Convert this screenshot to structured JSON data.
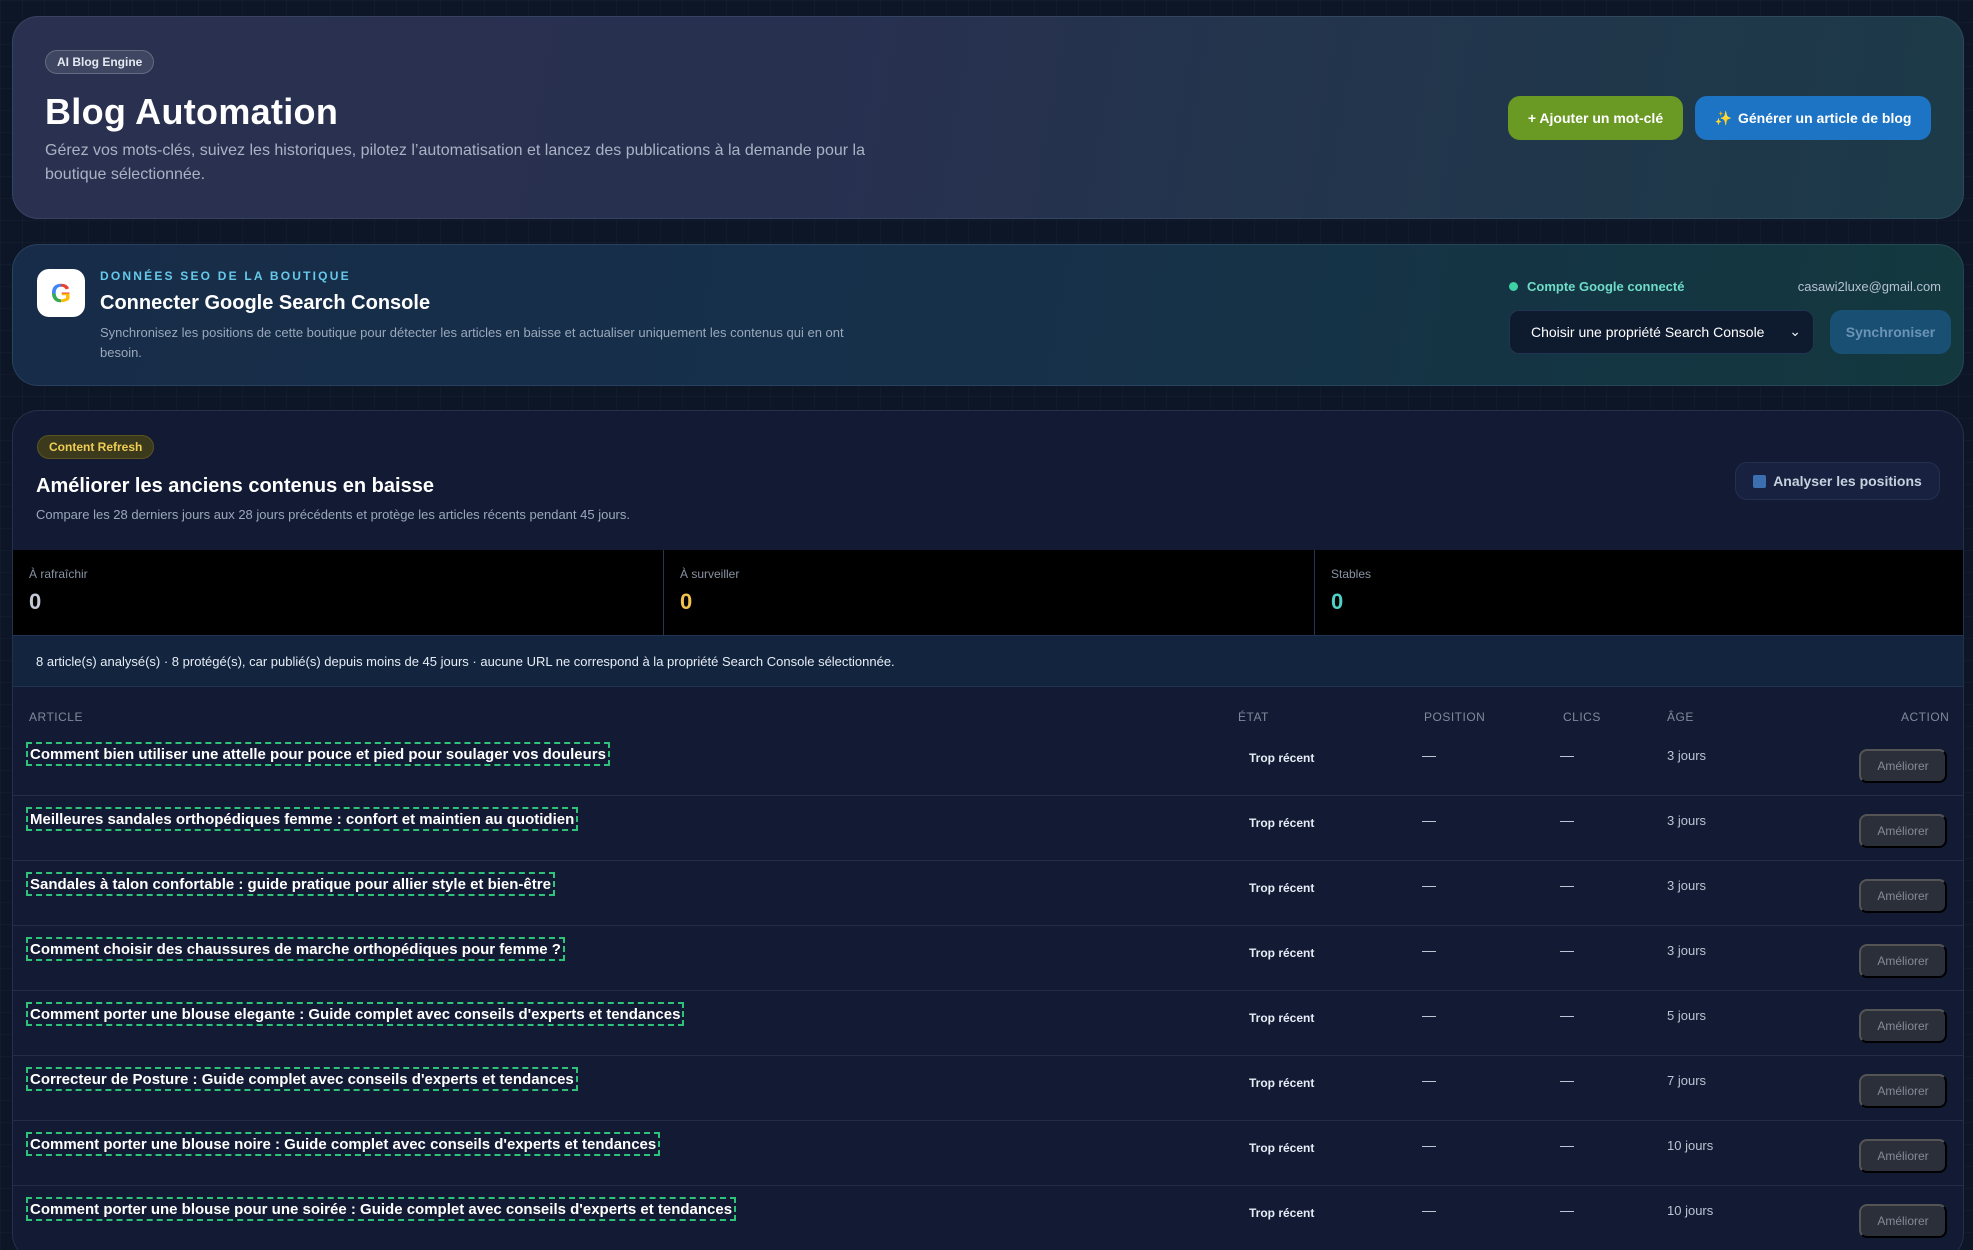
{
  "hero": {
    "badge": "AI Blog Engine",
    "title": "Blog Automation",
    "description": "Gérez vos mots-clés, suivez les historiques, pilotez l’automatisation et lancez des publications à la demande pour la boutique sélectionnée.",
    "add_keyword_label": "+ Ajouter un mot-clé",
    "generate_label": "Générer un article de blog",
    "generate_icon": "sparkles-icon",
    "colors": {
      "green": "#6a9a24",
      "blue": "#1d74c4"
    }
  },
  "gsc": {
    "kicker": "DONNÉES SEO DE LA BOUTIQUE",
    "title": "Connecter Google Search Console",
    "description": "Synchronisez les positions de cette boutique pour détecter les articles en baisse et actualiser uniquement les contenus qui en ont besoin.",
    "connected_label": "Compte Google connecté",
    "email": "casawi2luxe@gmail.com",
    "property_select": "Choisir une propriété Search Console",
    "sync_label": "Synchroniser",
    "logo_letter": "G"
  },
  "refresh": {
    "badge": "Content Refresh",
    "title": "Améliorer les anciens contenus en baisse",
    "description": "Compare les 28 derniers jours aux 28 jours précédents et protège les articles récents pendant 45 jours.",
    "analyze_label": "Analyser les positions",
    "stats": [
      {
        "label": "À rafraîchir",
        "value": "0",
        "color": "#c3cad6"
      },
      {
        "label": "À surveiller",
        "value": "0",
        "color": "#f2c14e"
      },
      {
        "label": "Stables",
        "value": "0",
        "color": "#4fd1c5"
      }
    ],
    "info": "8 article(s) analysé(s) · 8 protégé(s), car publié(s) depuis moins de 45 jours · aucune URL ne correspond à la propriété Search Console sélectionnée.",
    "columns": {
      "article": "ARTICLE",
      "state": "ÉTAT",
      "position": "POSITION",
      "clicks": "CLICS",
      "age": "ÂGE",
      "action": "ACTION"
    },
    "rows": [
      {
        "title": "Comment bien utiliser une attelle pour pouce et pied pour soulager vos douleurs",
        "state": "Trop récent",
        "position": "—",
        "clicks": "—",
        "age": "3 jours",
        "action": "Améliorer"
      },
      {
        "title": "Meilleures sandales orthopédiques femme : confort et maintien au quotidien",
        "state": "Trop récent",
        "position": "—",
        "clicks": "—",
        "age": "3 jours",
        "action": "Améliorer"
      },
      {
        "title": "Sandales à talon confortable : guide pratique pour allier style et bien-être",
        "state": "Trop récent",
        "position": "—",
        "clicks": "—",
        "age": "3 jours",
        "action": "Améliorer"
      },
      {
        "title": "Comment choisir des chaussures de marche orthopédiques pour femme ?",
        "state": "Trop récent",
        "position": "—",
        "clicks": "—",
        "age": "3 jours",
        "action": "Améliorer"
      },
      {
        "title": "Comment porter une blouse elegante : Guide complet avec conseils d'experts et tendances",
        "state": "Trop récent",
        "position": "—",
        "clicks": "—",
        "age": "5 jours",
        "action": "Améliorer"
      },
      {
        "title": "Correcteur de Posture : Guide complet avec conseils d'experts et tendances",
        "state": "Trop récent",
        "position": "—",
        "clicks": "—",
        "age": "7 jours",
        "action": "Améliorer"
      },
      {
        "title": "Comment porter une blouse noire : Guide complet avec conseils d'experts et tendances",
        "state": "Trop récent",
        "position": "—",
        "clicks": "—",
        "age": "10 jours",
        "action": "Améliorer"
      },
      {
        "title": "Comment porter une blouse pour une soirée : Guide complet avec conseils d'experts et tendances",
        "state": "Trop récent",
        "position": "—",
        "clicks": "—",
        "age": "10 jours",
        "action": "Améliorer"
      }
    ]
  }
}
